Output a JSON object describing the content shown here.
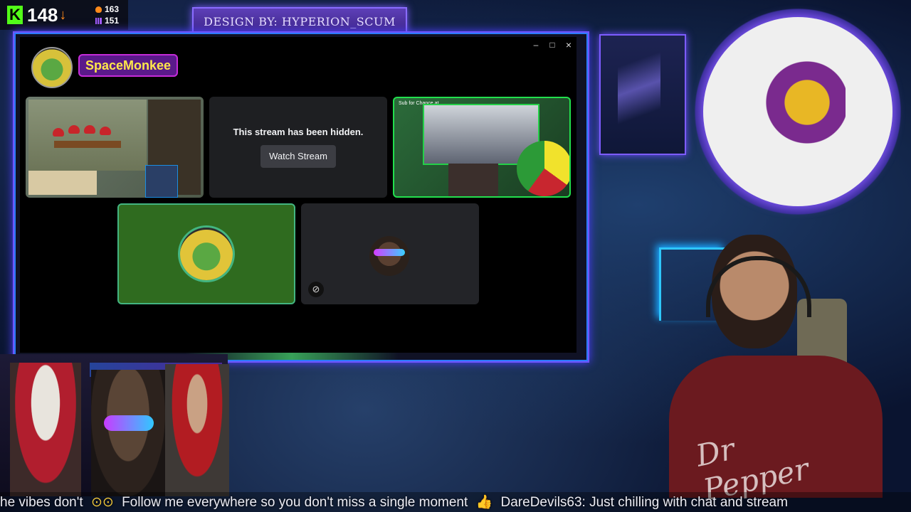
{
  "counters": {
    "kick_logo": "K",
    "kick_count": "148",
    "kick_arrow": "↓",
    "followers": "163",
    "subs": "151"
  },
  "banner": {
    "text": "DESIGN BY: HYPERION_SCUM"
  },
  "discord": {
    "host_name": "SpaceMonkee",
    "window_buttons": [
      "–",
      "□",
      "×"
    ],
    "tiles": {
      "hidden": {
        "message": "This stream has been hidden.",
        "button_label": "Watch Stream"
      },
      "third_title": "Sub for Chance at"
    },
    "mute_icon": "⊘"
  },
  "overlay": {
    "shirt_logo": "Dr Pepper"
  },
  "ticker": {
    "part1": "he vibes don't",
    "part2": "Follow me everywhere so you don't miss a single moment",
    "separator": "👍",
    "part3": "DareDevils63: Just chilling with chat and stream"
  },
  "colors": {
    "kick_green": "#53fc18",
    "accent_purple": "#7d5cff",
    "host_name_yellow": "#ffe84a",
    "speaking_green": "#43b581"
  }
}
